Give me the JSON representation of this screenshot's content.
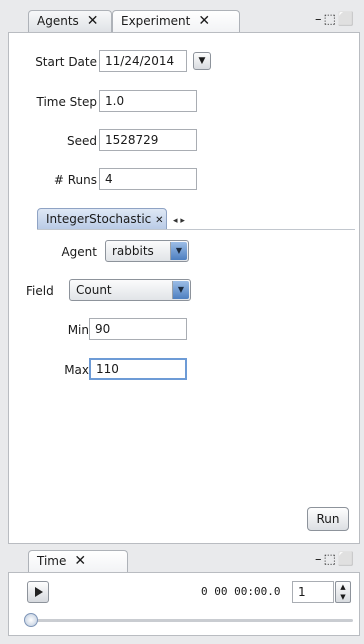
{
  "experiment_panel": {
    "tabs": [
      {
        "label": "Agents"
      },
      {
        "label": "Experiment"
      }
    ],
    "tab_close_glyph": "✕",
    "window_controls": "–⬚⬜",
    "start_date": {
      "label": "Start Date",
      "value": "11/24/2014"
    },
    "time_step": {
      "label": "Time Step",
      "value": "1.0"
    },
    "seed": {
      "label": "Seed",
      "value": "1528729"
    },
    "runs": {
      "label": "# Runs",
      "value": "4"
    },
    "subtab": {
      "label": "IntegerStochastic",
      "scroll_glyph": "◂ ▸"
    },
    "agent": {
      "label": "Agent",
      "value": "rabbits"
    },
    "field": {
      "label": "Field",
      "value": "Count"
    },
    "min": {
      "label": "Min",
      "value": "90"
    },
    "max": {
      "label": "Max",
      "value": "110"
    },
    "run_button": "Run"
  },
  "time_panel": {
    "tab": {
      "label": "Time"
    },
    "time_display": "0 00 00:00.0",
    "speed_value": "1",
    "slider_position": 0
  },
  "icons": {
    "close": "close-icon",
    "dropdown": "chevron-down-icon",
    "play": "play-icon",
    "minimize": "minimize-icon",
    "maximize": "maximize-icon"
  },
  "colors": {
    "accent": "#4e7fc0",
    "background": "#e9eaec"
  }
}
